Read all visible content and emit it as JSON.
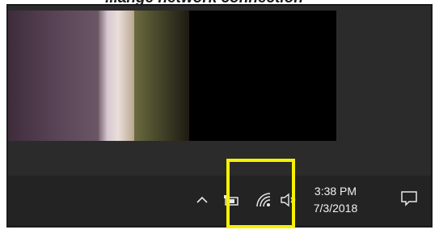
{
  "caption": "...ange network connection",
  "taskbar": {
    "clock": {
      "time": "3:38 PM",
      "date": "7/3/2018"
    },
    "icons": [
      "chevron-up-icon",
      "battery-icon",
      "wifi-icon",
      "volume-icon",
      "action-center-icon"
    ]
  },
  "highlight_color": "#f5f100"
}
